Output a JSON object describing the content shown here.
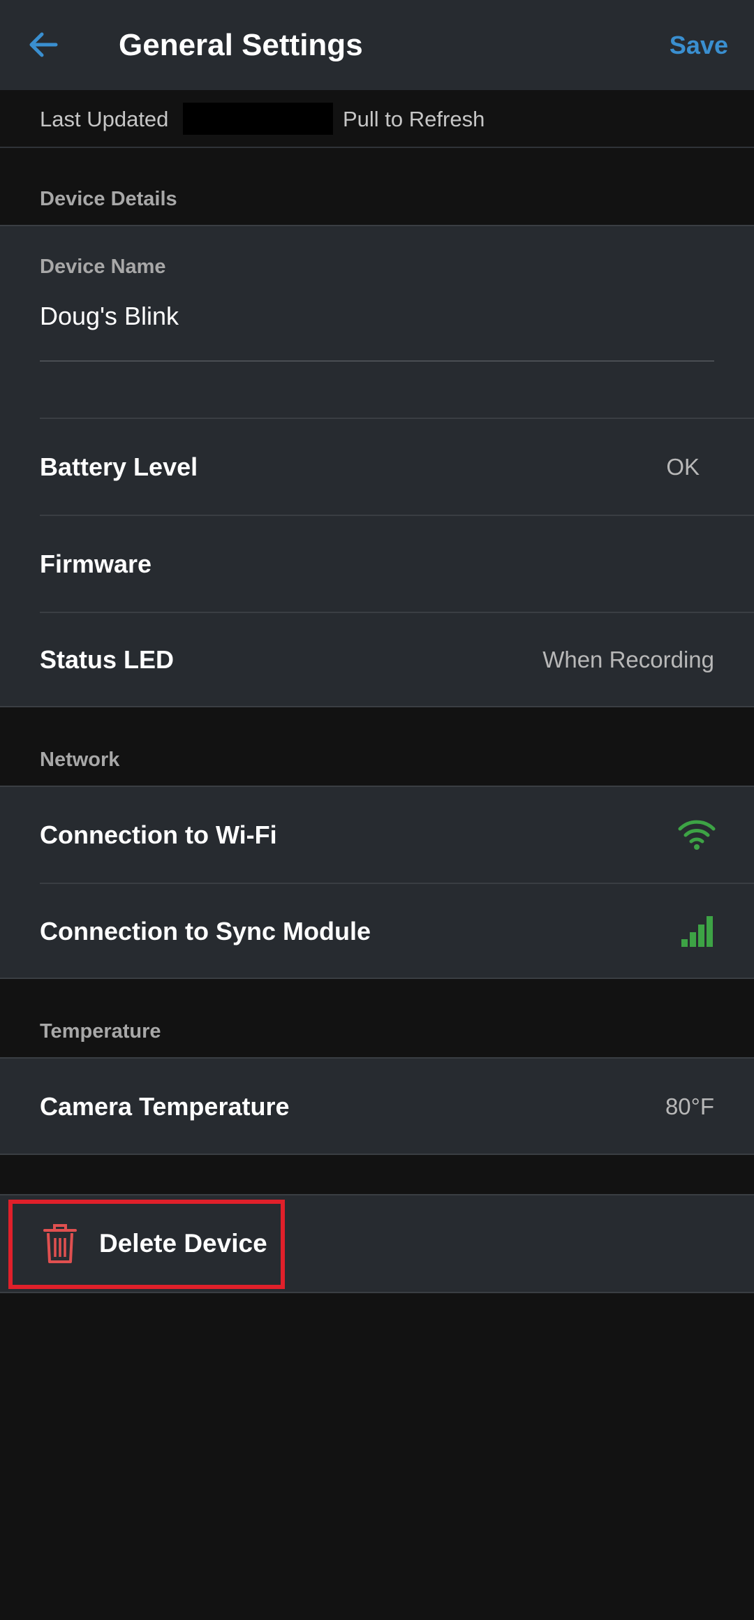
{
  "header": {
    "title": "General Settings",
    "save_label": "Save",
    "back_icon": "arrow-left-icon",
    "accent_color": "#3a8fd0"
  },
  "update_strip": {
    "last_updated_label": "Last Updated",
    "pull_label": "Pull to Refresh"
  },
  "device_details": {
    "section_title": "Device Details",
    "device_name_label": "Device Name",
    "device_name_value": "Doug's Blink",
    "battery_label": "Battery Level",
    "battery_value": "OK",
    "firmware_label": "Firmware",
    "status_led_label": "Status LED",
    "status_led_value": "When Recording"
  },
  "network": {
    "section_title": "Network",
    "wifi_label": "Connection to Wi-Fi",
    "wifi_icon": "wifi-signal-icon",
    "sync_label": "Connection to Sync Module",
    "sync_icon": "signal-bars-icon",
    "signal_color": "#3da345"
  },
  "temperature": {
    "section_title": "Temperature",
    "camera_temp_label": "Camera Temperature",
    "camera_temp_value": "80°F"
  },
  "delete": {
    "label": "Delete Device",
    "icon": "trash-icon",
    "icon_color": "#e05050",
    "highlight_color": "#e0202a"
  }
}
